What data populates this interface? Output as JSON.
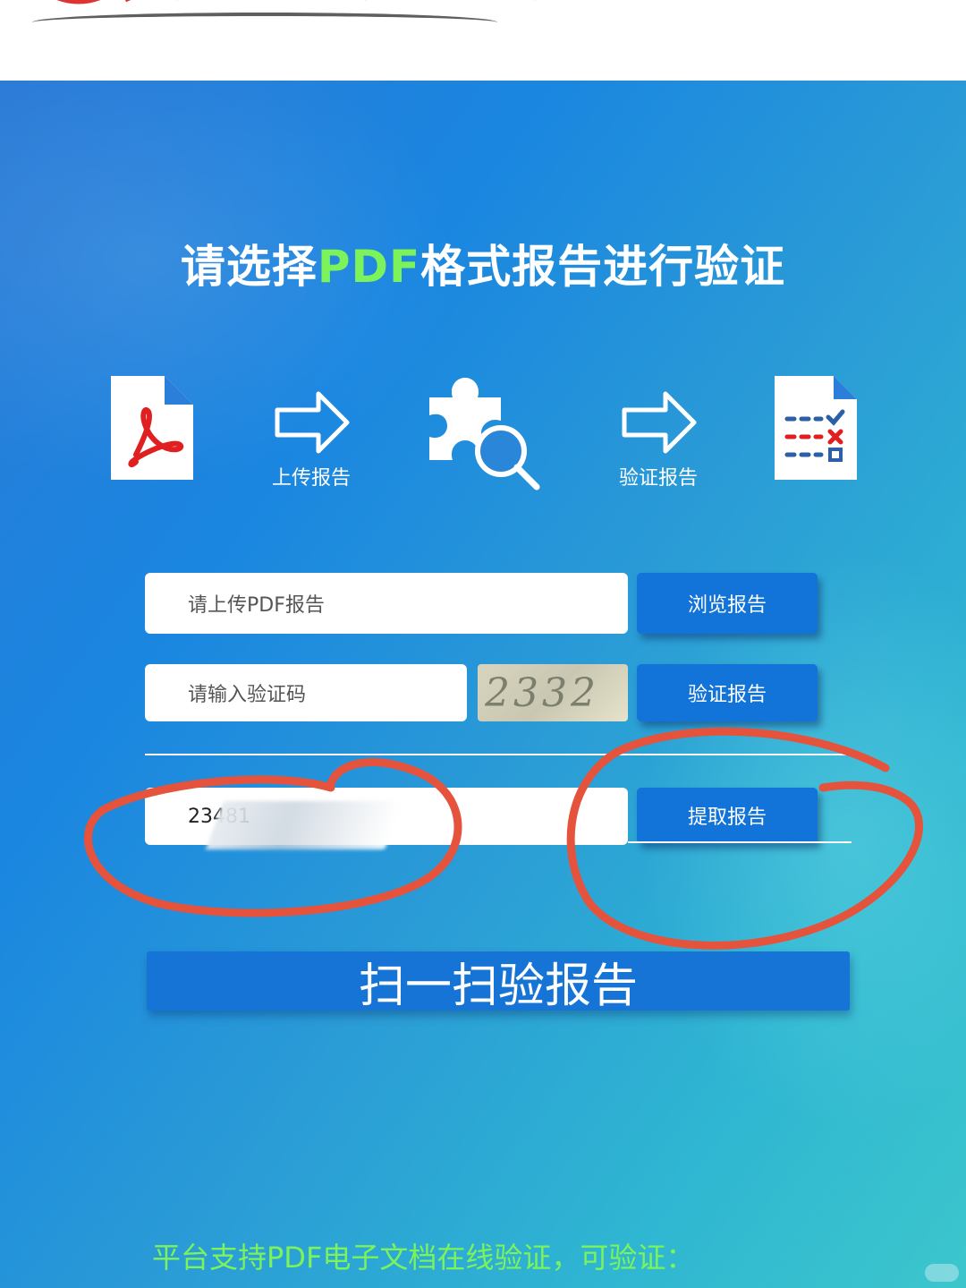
{
  "header": {
    "title_prefix": "请选择",
    "title_accent": "PDF",
    "title_suffix": "格式报告进行验证"
  },
  "steps": {
    "upload_label": "上传报告",
    "verify_label": "验证报告"
  },
  "form": {
    "upload_placeholder": "请上传PDF报告",
    "browse_button": "浏览报告",
    "code_placeholder": "请输入验证码",
    "captcha_text": "2332",
    "verify_button": "验证报告",
    "report_number_value": "23481",
    "extract_button": "提取报告"
  },
  "scan_button": "扫一扫验报告",
  "footer_note": "平台支持PDF电子文档在线验证，可验证：",
  "colors": {
    "accent_green": "#7CF35A",
    "button_blue": "#1273d9",
    "annotation_red": "#e5533c"
  }
}
